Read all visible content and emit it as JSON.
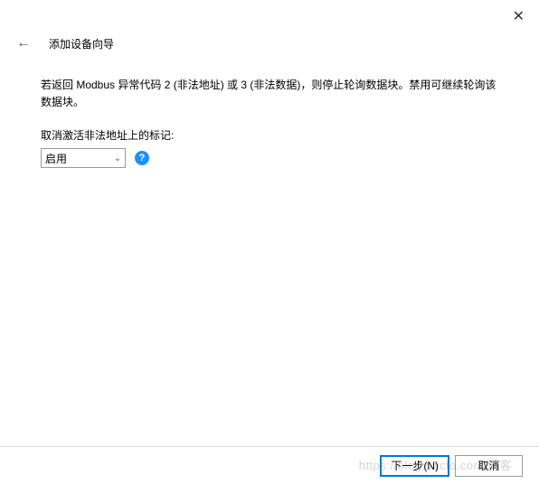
{
  "header": {
    "title": "添加设备向导"
  },
  "content": {
    "description": "若返回 Modbus 异常代码 2 (非法地址) 或 3 (非法数据)，则停止轮询数据块。禁用可继续轮询该数据块。",
    "deactivate_label": "取消激活非法地址上的标记:",
    "dropdown_value": "启用",
    "help_icon_text": "?"
  },
  "footer": {
    "next_label": "下一步(N)",
    "cancel_label": "取消"
  },
  "watermark": "https://blog.51cto.com/博客"
}
